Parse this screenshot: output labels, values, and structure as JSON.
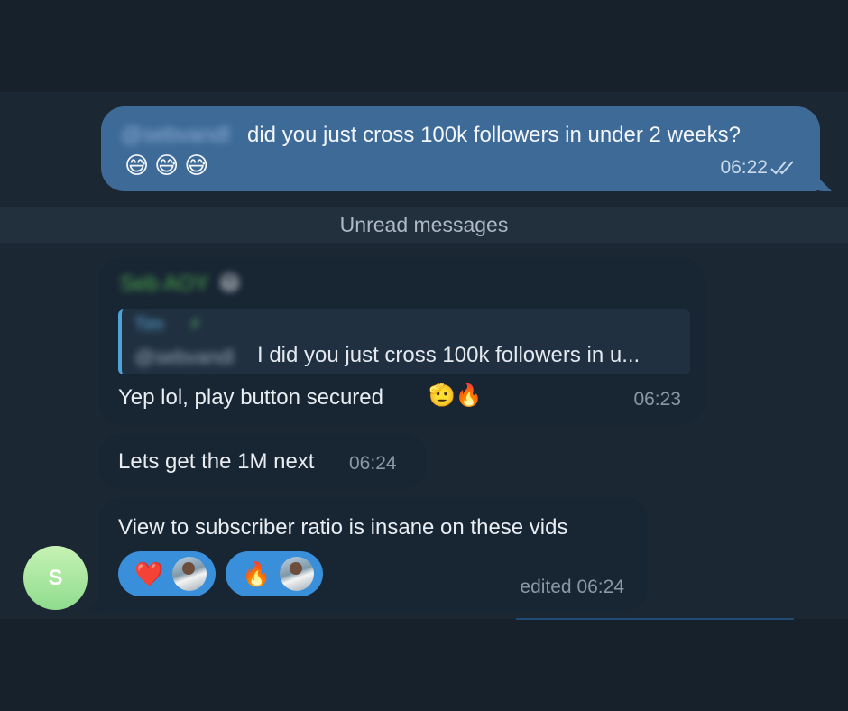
{
  "outgoing": {
    "mention": "@sebvandl",
    "text": "did you just cross 100k followers in under 2 weeks?",
    "emojis": "😅😅😅",
    "time": "06:22"
  },
  "divider": {
    "label": "Unread messages"
  },
  "messages": [
    {
      "sender": "Seb AOY",
      "sender_emoji": "😷",
      "reply": {
        "name": "Tim",
        "name_icon": "lightning-icon",
        "mention": "@sebvandl",
        "text": "I did you just cross 100k followers in u..."
      },
      "text": "Yep lol, play button secured",
      "emojis": "🫡🔥",
      "time": "06:23"
    },
    {
      "text": "Lets get the 1M next",
      "time": "06:24"
    },
    {
      "text": "View to subscriber ratio is insane on these vids",
      "reactions": [
        {
          "emoji": "❤️"
        },
        {
          "emoji": "🔥"
        }
      ],
      "time": "edited 06:24"
    }
  ],
  "avatar": {
    "initial": "S"
  },
  "colors": {
    "background": "#17212b",
    "outgoing_bubble": "#3d6a97",
    "incoming_bubble": "#182533",
    "accent": "#3a8fdb",
    "sender_name": "#4fae4e"
  }
}
